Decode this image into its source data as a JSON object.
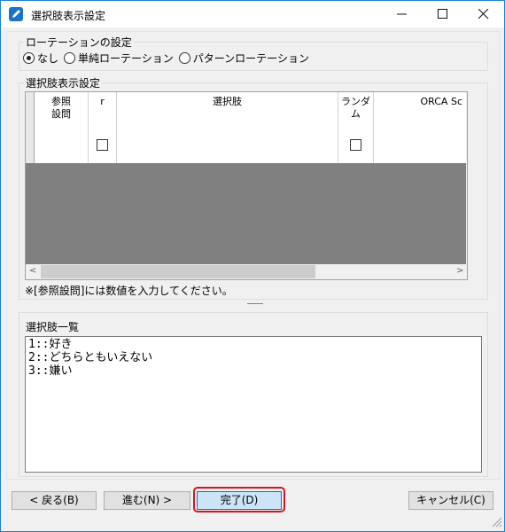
{
  "window": {
    "title": "選択肢表示設定",
    "icon": "edit-icon",
    "controls": [
      "minimize-icon",
      "maximize-icon",
      "close-icon"
    ]
  },
  "rotation": {
    "label": "ローテーションの設定",
    "options": [
      {
        "label": "なし",
        "checked": true
      },
      {
        "label": "単純ローテーション",
        "checked": false
      },
      {
        "label": "パターンローテーション",
        "checked": false
      }
    ]
  },
  "grid": {
    "label": "選択肢表示設定",
    "columns": [
      "参照\n設問",
      "r",
      "選択肢",
      "ランダム",
      "ORCA Sc"
    ],
    "rows": [
      {
        "ref": "",
        "r": false,
        "choice": "",
        "random": false,
        "orca": ""
      }
    ]
  },
  "note": "※[参照設問]には数値を入力してください。",
  "list": {
    "label": "選択肢一覧",
    "lines": [
      "1::好き",
      "2::どちらともいえない",
      "3::嫌い"
    ]
  },
  "buttons": {
    "back": "< 戻る(B)",
    "next": "進む(N) >",
    "finish": "完了(D)",
    "cancel": "キャンセル(C)"
  },
  "colors": {
    "accent": "#0078d7",
    "highlight": "#d9141c",
    "grid_background": "#808080"
  }
}
